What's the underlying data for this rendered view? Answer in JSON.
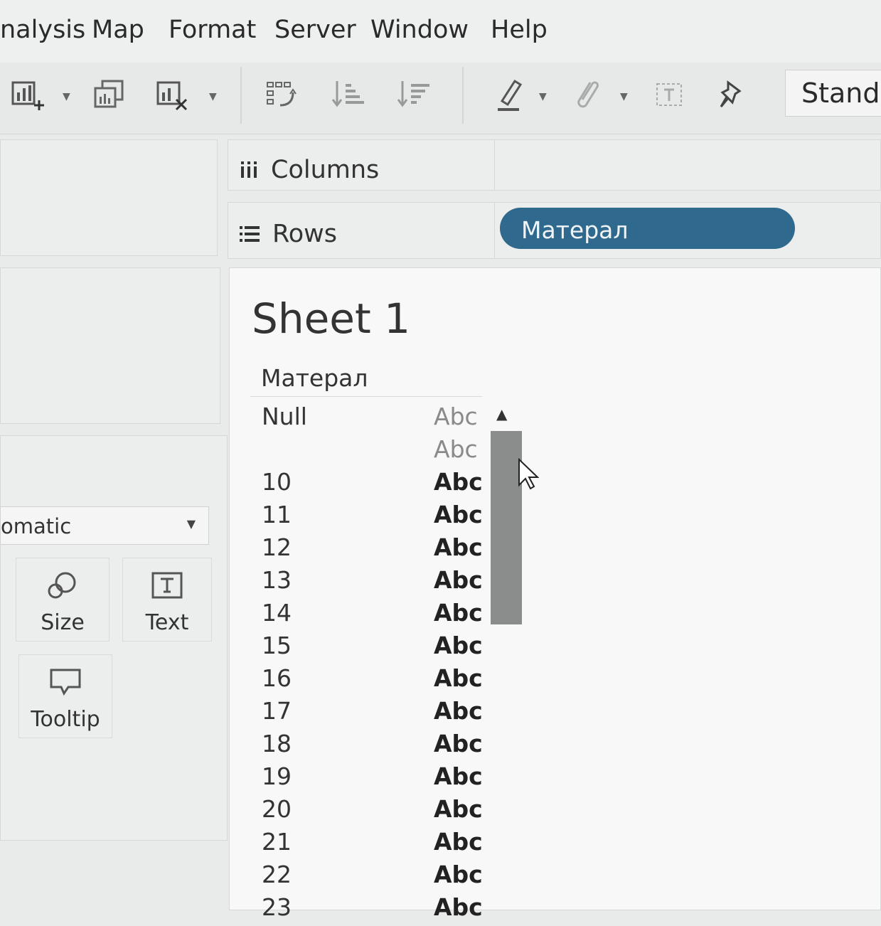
{
  "menu": {
    "items": [
      "nalysis",
      "Map",
      "Format",
      "Server",
      "Window",
      "Help"
    ]
  },
  "toolbar": {
    "icons": [
      "new-worksheet-icon",
      "duplicate-sheet-icon",
      "clear-sheet-icon",
      "swap-rows-columns-icon",
      "sort-ascending-icon",
      "sort-descending-icon",
      "highlight-icon",
      "group-icon",
      "show-labels-icon",
      "pin-icon"
    ],
    "fit_value": "Standa"
  },
  "marks": {
    "type_value": "omatic",
    "size_label": "Size",
    "text_label": "Text",
    "tooltip_label": "Tooltip"
  },
  "shelves": {
    "columns_label": "Columns",
    "rows_label": "Rows",
    "rows_pill": "Матерал"
  },
  "view": {
    "sheet_title": "Sheet 1",
    "field_header": "Матерал",
    "rows": [
      {
        "key": "Null",
        "value": "Abc",
        "muted": true
      },
      {
        "key": "",
        "value": "Abc",
        "muted": true
      },
      {
        "key": "10",
        "value": "Abc",
        "muted": false
      },
      {
        "key": "11",
        "value": "Abc",
        "muted": false
      },
      {
        "key": "12",
        "value": "Abc",
        "muted": false
      },
      {
        "key": "13",
        "value": "Abc",
        "muted": false
      },
      {
        "key": "14",
        "value": "Abc",
        "muted": false
      },
      {
        "key": "15",
        "value": "Abc",
        "muted": false
      },
      {
        "key": "16",
        "value": "Abc",
        "muted": false
      },
      {
        "key": "17",
        "value": "Abc",
        "muted": false
      },
      {
        "key": "18",
        "value": "Abc",
        "muted": false
      },
      {
        "key": "19",
        "value": "Abc",
        "muted": false
      },
      {
        "key": "20",
        "value": "Abc",
        "muted": false
      },
      {
        "key": "21",
        "value": "Abc",
        "muted": false
      },
      {
        "key": "22",
        "value": "Abc",
        "muted": false
      },
      {
        "key": "23",
        "value": "Abc",
        "muted": false
      }
    ]
  },
  "colors": {
    "pill": "#2f6a8e",
    "scroll_thumb": "#8b8d8c"
  }
}
